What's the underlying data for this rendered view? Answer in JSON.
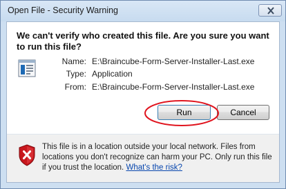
{
  "window": {
    "title": "Open File - Security Warning"
  },
  "prompt": {
    "heading": "We can't verify who created this file. Are you sure you want to run this file?"
  },
  "details": {
    "name_label": "Name:",
    "name_value": "E:\\Braincube-Form-Server-Installer-Last.exe",
    "type_label": "Type:",
    "type_value": "Application",
    "from_label": "From:",
    "from_value": "E:\\Braincube-Form-Server-Installer-Last.exe"
  },
  "buttons": {
    "run_label": "Run",
    "cancel_label": "Cancel"
  },
  "footer": {
    "warning_text": "This file is in a location outside your local network. Files from locations you don't recognize can harm your PC. Only run this file if you trust the location.",
    "risk_link": "What's the risk?"
  },
  "icons": {
    "close": "close-icon",
    "file": "application-file-icon",
    "shield": "security-shield-icon"
  },
  "colors": {
    "highlight": "#e0141e",
    "link": "#0645ad",
    "shield_red": "#c8171d"
  }
}
